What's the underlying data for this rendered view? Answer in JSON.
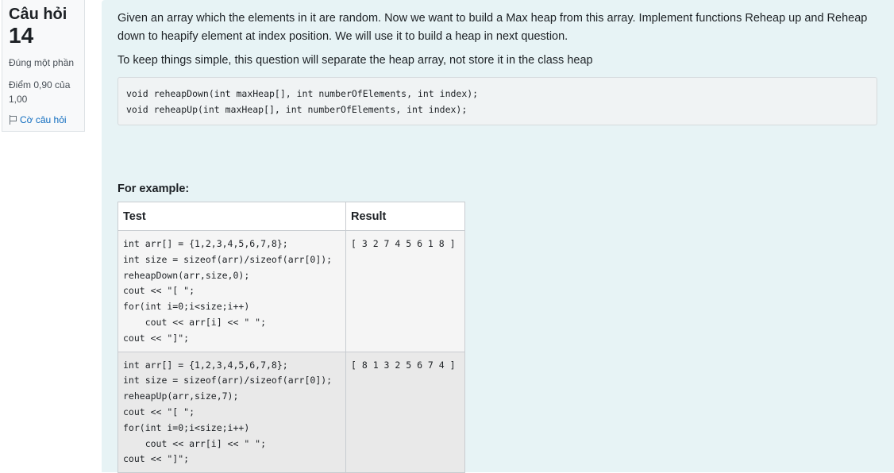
{
  "info": {
    "question_label": "Câu hỏi",
    "question_number": "14",
    "state": "Đúng một phần",
    "grade": "Điểm 0,90 của 1,00",
    "flag_label": "Cờ câu hỏi"
  },
  "question": {
    "paragraph1": "Given an array which the elements in it are random. Now we want to build a Max heap from this array. Implement functions Reheap up and Reheap down to heapify element at index position. We will use it to build a heap in next question.",
    "paragraph2": "To keep things simple, this question will separate the heap array, not store it in the class heap",
    "code": "void reheapDown(int maxHeap[], int numberOfElements, int index);\nvoid reheapUp(int maxHeap[], int numberOfElements, int index);",
    "example_heading": "For example:"
  },
  "example_table": {
    "headers": [
      "Test",
      "Result"
    ],
    "rows": [
      {
        "test": "int arr[] = {1,2,3,4,5,6,7,8};\nint size = sizeof(arr)/sizeof(arr[0]);\nreheapDown(arr,size,0);\ncout << \"[ \";\nfor(int i=0;i<size;i++)\n    cout << arr[i] << \" \";\ncout << \"]\";",
        "result": "[ 3 2 7 4 5 6 1 8 ]"
      },
      {
        "test": "int arr[] = {1,2,3,4,5,6,7,8};\nint size = sizeof(arr)/sizeof(arr[0]);\nreheapUp(arr,size,7);\ncout << \"[ \";\nfor(int i=0;i<size;i++)\n    cout << arr[i] << \" \";\ncout << \"]\";",
        "result": "[ 8 1 3 2 5 6 7 4 ]"
      }
    ]
  }
}
